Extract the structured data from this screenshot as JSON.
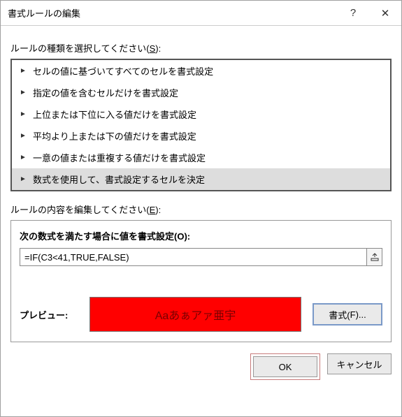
{
  "titlebar": {
    "title": "書式ルールの編集",
    "help": "?",
    "close": "✕"
  },
  "labels": {
    "rule_type_prefix": "ルールの種類を選択してください(",
    "rule_type_key": "S",
    "rule_type_suffix": "):",
    "rule_edit_prefix": "ルールの内容を編集してください(",
    "rule_edit_key": "E",
    "rule_edit_suffix": "):"
  },
  "rule_types": [
    "セルの値に基づいてすべてのセルを書式設定",
    "指定の値を含むセルだけを書式設定",
    "上位または下位に入る値だけを書式設定",
    "平均より上または下の値だけを書式設定",
    "一意の値または重複する値だけを書式設定",
    "数式を使用して、書式設定するセルを決定"
  ],
  "rule_selected_index": 5,
  "edit": {
    "section_prefix": "次の数式を満たす場合に値を書式設定(",
    "section_key": "O",
    "section_suffix": "):",
    "formula": "=IF(C3<41,TRUE,FALSE)"
  },
  "preview": {
    "label": "プレビュー:",
    "sample_text": "Aaあぁアァ亜宇",
    "format_btn_prefix": "書式(",
    "format_btn_key": "F",
    "format_btn_suffix": ")..."
  },
  "dialog": {
    "ok": "OK",
    "cancel": "キャンセル"
  }
}
